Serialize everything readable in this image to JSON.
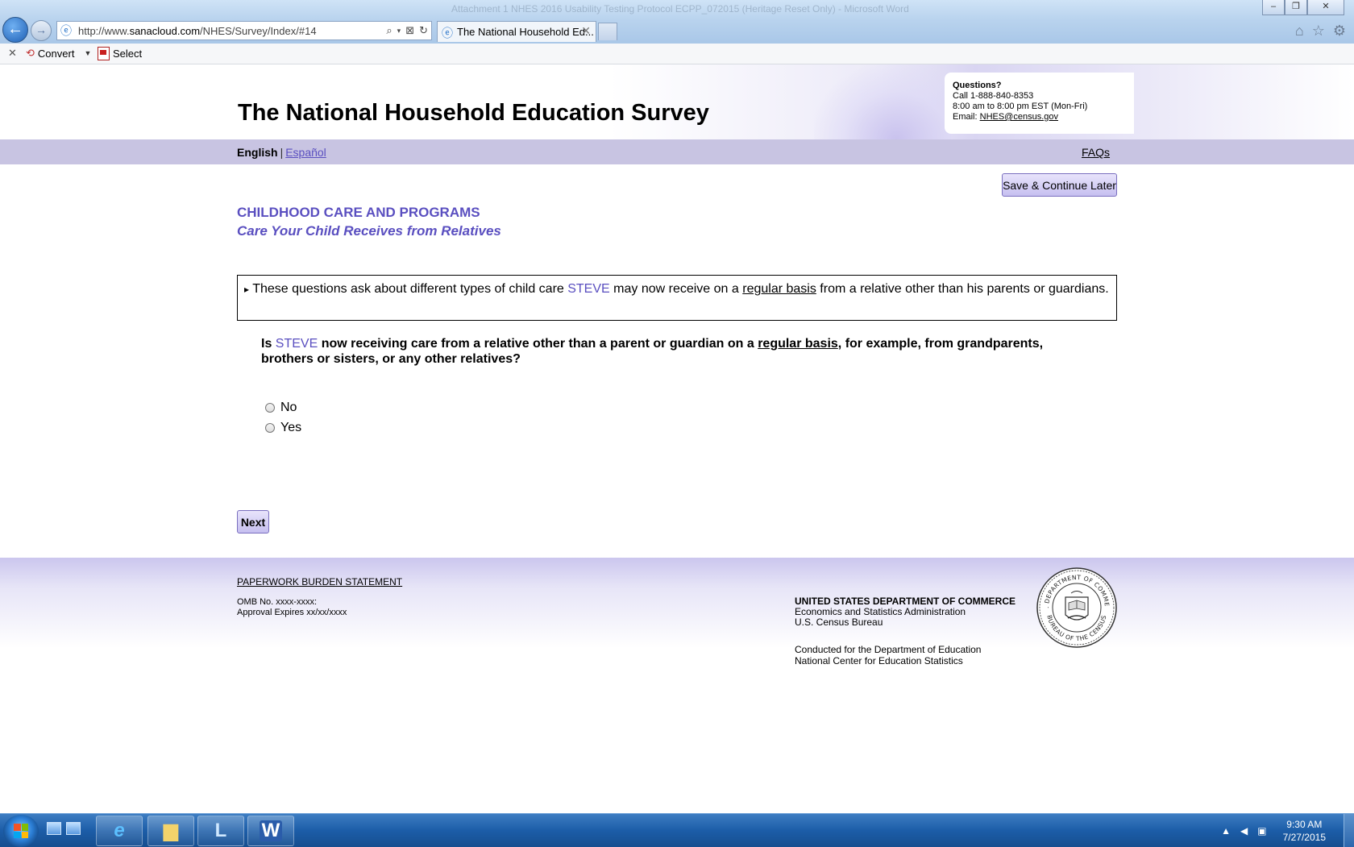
{
  "browser": {
    "window_title": "Attachment 1 NHES 2016 Usability Testing Protocol ECPP_072015 (Heritage Reset Only) - Microsoft Word",
    "address_prefix": "http://www.",
    "address_domain": "sanacloud.com",
    "address_path": "/NHES/Survey/Index/#14",
    "tab_title": "The National Household Ed...",
    "command_bar": {
      "convert_label": "Convert",
      "select_label": "Select"
    }
  },
  "header": {
    "site_title": "The National Household Education Survey",
    "contact": {
      "heading": "Questions?",
      "phone": "Call 1-888-840-8353",
      "hours": "8:00 am to 8:00 pm EST (Mon-Fri)",
      "email_prefix": "Email: ",
      "email": "NHES@census.gov"
    }
  },
  "langbar": {
    "english": "English",
    "separator": "|",
    "espanol": "Español",
    "faqs": "FAQs"
  },
  "actions": {
    "save_label": "Save & Continue Later",
    "next_label": "Next"
  },
  "section": {
    "title": "CHILDHOOD CARE AND PROGRAMS",
    "subtitle": "Care Your Child Receives from Relatives"
  },
  "info": {
    "arrow": "▸",
    "p1": " These questions ask about different types of child care ",
    "name": "STEVE",
    "p2": " may now receive on a ",
    "term": "regular basis",
    "p3": " from a relative other than his parents or guardians."
  },
  "question": {
    "p1": "Is ",
    "name": "STEVE",
    "p2": " now receiving care from a relative other than a parent or guardian on a ",
    "term": "regular basis",
    "p3": ", for example, from grandparents, brothers or sisters, or any other relatives?"
  },
  "options": [
    {
      "label": "No",
      "selected": false
    },
    {
      "label": "Yes",
      "selected": false
    }
  ],
  "footer": {
    "paperwork": "PAPERWORK BURDEN STATEMENT",
    "omb": "OMB No. xxxx-xxxx:",
    "approval": "Approval Expires xx/xx/xxxx",
    "dept_name": "UNITED STATES DEPARTMENT OF COMMERCE",
    "dept_line2": "Economics and Statistics Administration",
    "dept_line3": "U.S. Census Bureau",
    "conducted_line1": "Conducted for the Department of Education",
    "conducted_line2": "National Center for Education Statistics",
    "seal_top_text": "U.S. DEPARTMENT OF COMMERCE",
    "seal_bottom_text": "BUREAU OF THE CENSUS"
  },
  "taskbar": {
    "time": "9:30 AM",
    "date": "7/27/2015",
    "apps": [
      "internet-explorer",
      "file-explorer",
      "lync",
      "word"
    ]
  },
  "colors": {
    "accent": "#5a4fc0",
    "langbar": "#c8c4e2",
    "taskbar": "#1c5da8"
  }
}
